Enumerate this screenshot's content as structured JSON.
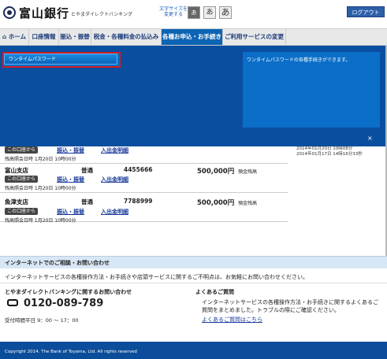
{
  "header": {
    "bank_name": "富山銀行",
    "service_name": "とやまダイレクトバンキング",
    "font_size_label": "文字サイズを変更する",
    "font_small": "あ",
    "font_medium": "あ",
    "font_large": "あ",
    "logout": "ログアウト"
  },
  "nav": {
    "home": "ホーム",
    "account": "口座情報",
    "transfer": "振込・振替",
    "tax": "税金・各種料金の払込み",
    "apply": "各種お申込・お手続き",
    "services": "ご利用サービスの変更"
  },
  "overlay": {
    "otp_button": "ワンタイムパスワード",
    "description": "ワンタイムパスワードの各種手続きができます。",
    "close": "×"
  },
  "history_dates": {
    "line1": "2014年01月20日 10時08分",
    "line2": "2014年01月17日 14時16分33秒"
  },
  "accounts": [
    {
      "tag": "この口座から",
      "link1": "振込・振替",
      "link2": "入出金明細",
      "balance_label": "残高照会日時 1月20日 10時00分"
    },
    {
      "branch": "富山支店",
      "type": "普通",
      "number": "4455666",
      "amount": "500,000円",
      "amount_label": "預金残高",
      "tag": "この口座から",
      "link1": "振込・振替",
      "link2": "入出金明細",
      "balance_label": "残高照会日時 1月20日 10時00分"
    },
    {
      "branch": "魚津支店",
      "type": "普通",
      "number": "7788999",
      "amount": "500,000円",
      "amount_label": "預金残高",
      "tag": "この口座から",
      "link1": "振込・振替",
      "link2": "入出金明細",
      "balance_label": "残高照会日時 1月20日 10時00分"
    }
  ],
  "inquiry": {
    "title": "インターネットでのご相談・お問い合わせ",
    "description": "インターネットサービスの各種操作方法・お手続きや店頭サービスに関するご不明点は、お気軽にお問い合わせください。",
    "phone_heading": "とやまダイレクトバンキングに関するお問い合わせ",
    "phone": "0120-089-789",
    "hours": "受付時間平日 9：00 ～ 17：00",
    "faq_heading": "よくあるご質問",
    "faq_text": "インターネットサービスの各種操作方法・お手続きに関するよくあるご質問をまとめました。トラブルの際にご確認ください。",
    "faq_link": "よくあるご質問はこちら"
  },
  "footer": {
    "copyright": "Copyright 2014. The Bank of Toyama, Ltd. All rights reserved"
  }
}
